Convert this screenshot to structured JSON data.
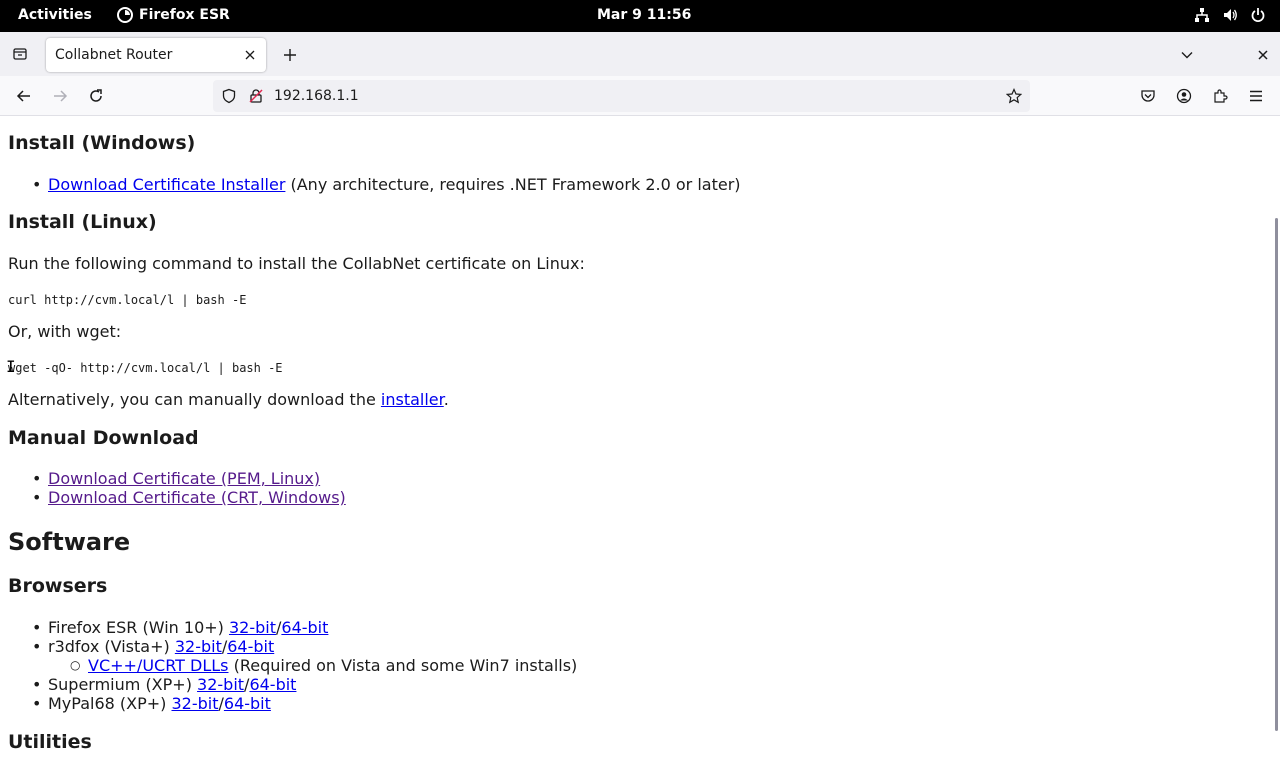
{
  "topbar": {
    "activities": "Activities",
    "app_name": "Firefox ESR",
    "clock": "Mar 9  11:56"
  },
  "browser": {
    "tab_title": "Collabnet Router",
    "url": "192.168.1.1"
  },
  "page": {
    "install_windows": {
      "heading": "Install (Windows)",
      "link": "Download Certificate Installer",
      "note": " (Any architecture, requires .NET Framework 2.0 or later)"
    },
    "install_linux": {
      "heading": "Install (Linux)",
      "intro": "Run the following command to install the CollabNet certificate on Linux:",
      "curl_cmd": "curl http://cvm.local/l | bash -E",
      "wget_intro": "Or, with wget:",
      "wget_cmd": "wget -qO- http://cvm.local/l | bash -E",
      "alt_prefix": "Alternatively, you can manually download the ",
      "alt_link": "installer",
      "alt_suffix": "."
    },
    "manual_download": {
      "heading": "Manual Download",
      "links": [
        "Download Certificate (PEM, Linux)",
        "Download Certificate (CRT, Windows)"
      ]
    },
    "software": {
      "heading": "Software",
      "browsers_heading": "Browsers",
      "browsers": [
        {
          "name": "Firefox ESR (Win 10+) ",
          "link32": "32-bit",
          "link64": "64-bit"
        },
        {
          "name": "r3dfox (Vista+) ",
          "link32": "32-bit",
          "link64": "64-bit"
        },
        {
          "name": "Supermium (XP+) ",
          "link32": "32-bit",
          "link64": "64-bit"
        },
        {
          "name": "MyPal68 (XP+) ",
          "link32": "32-bit",
          "link64": "64-bit"
        }
      ],
      "sep": "/",
      "r3dfox_sub": {
        "link": "VC++/UCRT DLLs",
        "note": " (Required on Vista and some Win7 installs)"
      },
      "utilities_heading": "Utilities"
    }
  },
  "colors": {
    "link": "#0000ee",
    "visited": "#551a8b"
  },
  "icons": [
    "firefox-icon",
    "network-icon",
    "volume-icon",
    "power-icon",
    "tab-list-icon",
    "close-icon",
    "plus-icon",
    "chevron-down-icon",
    "back-icon",
    "forward-icon",
    "reload-icon",
    "shield-icon",
    "insecure-lock-icon",
    "star-icon",
    "pocket-icon",
    "account-icon",
    "extensions-icon",
    "menu-icon"
  ]
}
